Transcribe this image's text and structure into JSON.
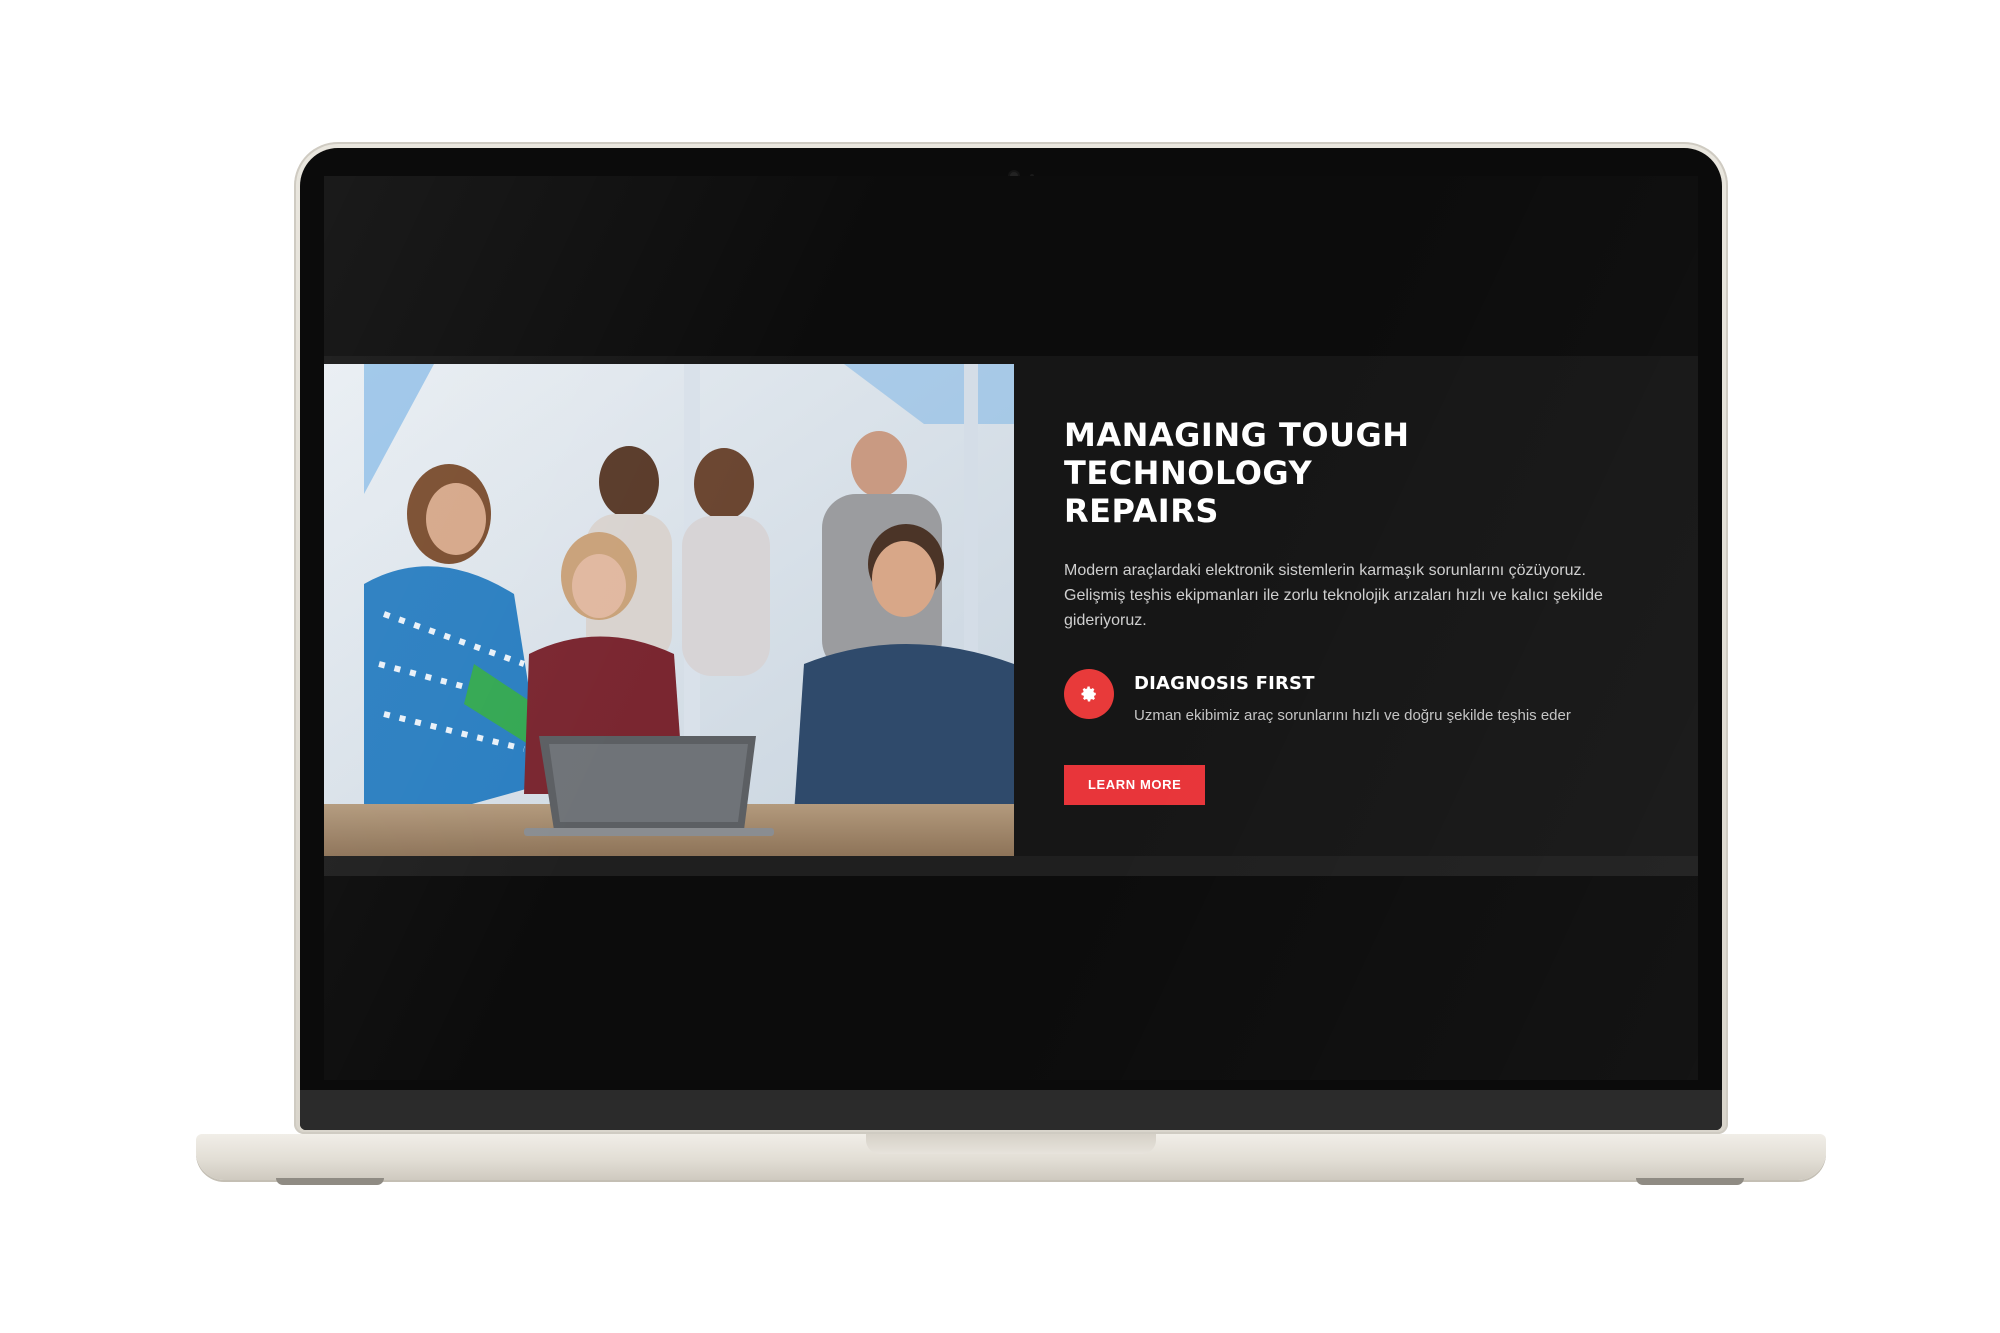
{
  "hero": {
    "title": "MANAGING TOUGH TECHNOLOGY REPAIRS",
    "description": "Modern araçlardaki elektronik sistemlerin karmaşık sorunlarını çözüyoruz. Gelişmiş teşhis ekipmanları ile zorlu teknolojik arızaları hızlı ve kalıcı şekilde gideriyoruz.",
    "photo_icon": "team-photo",
    "feature": {
      "icon": "gear-icon",
      "title": "DIAGNOSIS FIRST",
      "text": "Uzman ekibimiz araç sorunlarını hızlı ve doğru şekilde teşhis eder"
    },
    "cta_label": "LEARN MORE"
  },
  "colors": {
    "accent": "#e8353a",
    "section_bg": "#161616",
    "screen_bg": "#0c0c0c",
    "device": "#e6e2da"
  }
}
